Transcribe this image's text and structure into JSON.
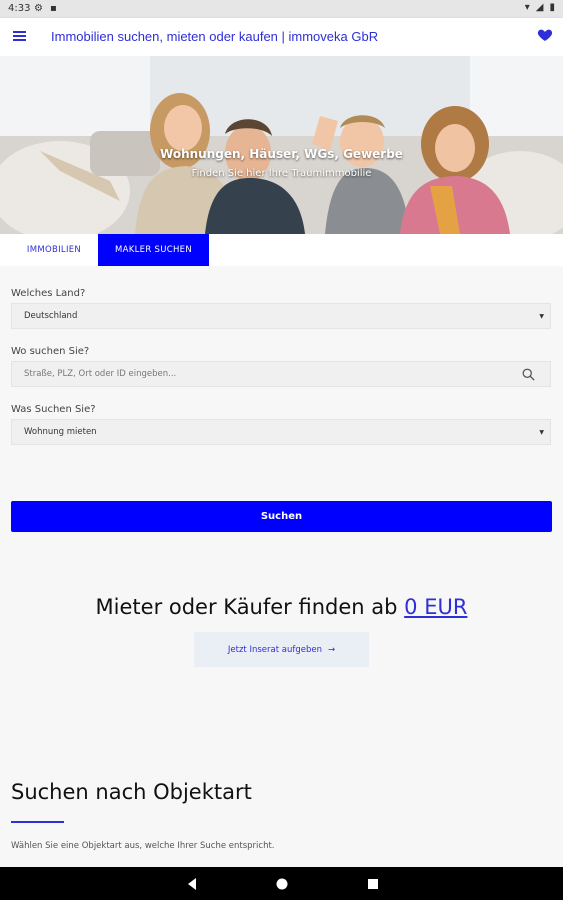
{
  "status_bar": {
    "time": "4:33",
    "icons": [
      "settings-icon",
      "sim-icon",
      "wifi-icon",
      "signal-icon",
      "battery-icon"
    ]
  },
  "app_bar": {
    "title": "Immobilien suchen, mieten oder kaufen | immoveka GbR",
    "menu_icon": "hamburger-menu-icon",
    "favorite_icon": "heart-icon"
  },
  "hero": {
    "headline": "Wohnungen, Häuser, WGs, Gewerbe",
    "subline": "Finden Sie hier Ihre Traumimmobilie"
  },
  "tabs": [
    {
      "label": "IMMOBILIEN",
      "active": false
    },
    {
      "label": "MAKLER SUCHEN",
      "active": true
    }
  ],
  "form": {
    "country_label": "Welches Land?",
    "country_value": "Deutschland",
    "location_label": "Wo suchen Sie?",
    "location_placeholder": "Straße, PLZ, Ort oder ID eingeben...",
    "type_label": "Was Suchen Sie?",
    "type_value": "Wohnung mieten",
    "search_button": "Suchen"
  },
  "promo": {
    "text": "Mieter oder Käufer finden ab",
    "price": "0 EUR",
    "button": "Jetzt Inserat aufgeben",
    "button_arrow": "→"
  },
  "objektart": {
    "title": "Suchen nach Objektart",
    "description": "Wählen Sie eine Objektart aus, welche Ihrer Suche entspricht."
  },
  "colors": {
    "accent": "#0000ff",
    "link": "#2f2fd7",
    "nav_bar": "#000000"
  }
}
